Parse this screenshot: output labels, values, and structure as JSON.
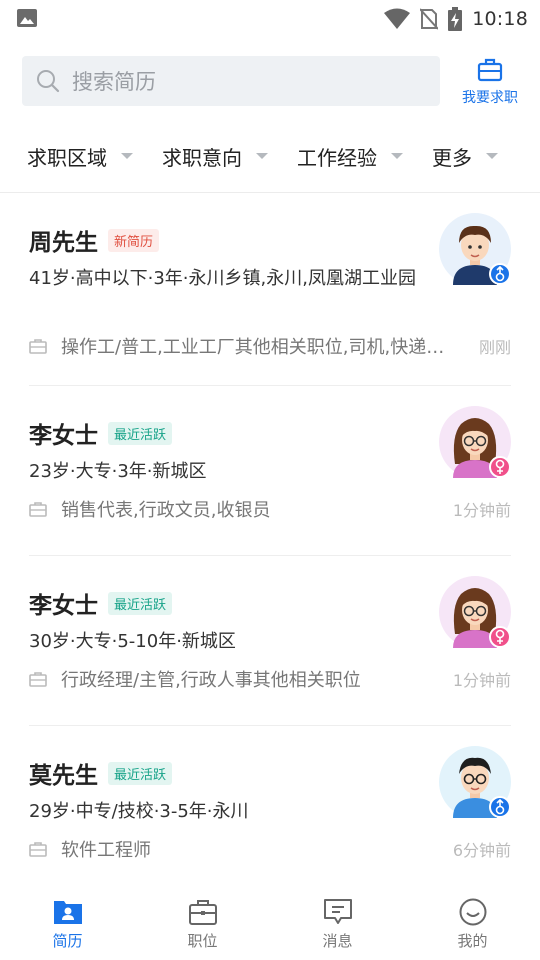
{
  "status_bar": {
    "time": "10:18"
  },
  "search": {
    "placeholder": "搜索简历"
  },
  "header": {
    "job_seek_label": "我要求职"
  },
  "filters": [
    {
      "label": "求职区域"
    },
    {
      "label": "求职意向"
    },
    {
      "label": "工作经验"
    },
    {
      "label": "更多"
    }
  ],
  "resumes": [
    {
      "name": "周先生",
      "badge": "新简历",
      "badge_type": "new",
      "meta": "41岁·高中以下·3年·永川乡镇,永川,凤凰湖工业园",
      "jobs": "操作工/普工,工业工厂其他相关职位,司机,快递…",
      "time": "刚刚",
      "gender": "male",
      "avatar_icon": "male-avatar-icon"
    },
    {
      "name": "李女士",
      "badge": "最近活跃",
      "badge_type": "active",
      "meta": "23岁·大专·3年·新城区",
      "jobs": "销售代表,行政文员,收银员",
      "time": "1分钟前",
      "gender": "female",
      "avatar_icon": "female-avatar-icon"
    },
    {
      "name": "李女士",
      "badge": "最近活跃",
      "badge_type": "active",
      "meta": "30岁·大专·5-10年·新城区",
      "jobs": "行政经理/主管,行政人事其他相关职位",
      "time": "1分钟前",
      "gender": "female",
      "avatar_icon": "female-avatar-icon"
    },
    {
      "name": "莫先生",
      "badge": "最近活跃",
      "badge_type": "active",
      "meta": "29岁·中专/技校·3-5年·永川",
      "jobs": "软件工程师",
      "time": "6分钟前",
      "gender": "male",
      "avatar_icon": "male-glasses-avatar-icon"
    }
  ],
  "bottom_nav": [
    {
      "label": "简历",
      "icon": "resume-icon",
      "active": true
    },
    {
      "label": "职位",
      "icon": "briefcase-icon",
      "active": false
    },
    {
      "label": "消息",
      "icon": "message-icon",
      "active": false
    },
    {
      "label": "我的",
      "icon": "profile-icon",
      "active": false
    }
  ],
  "colors": {
    "accent": "#1a73e8",
    "badge_new": "#e05040",
    "badge_active": "#17a389",
    "male": "#1a73e8",
    "female": "#f0508a"
  }
}
